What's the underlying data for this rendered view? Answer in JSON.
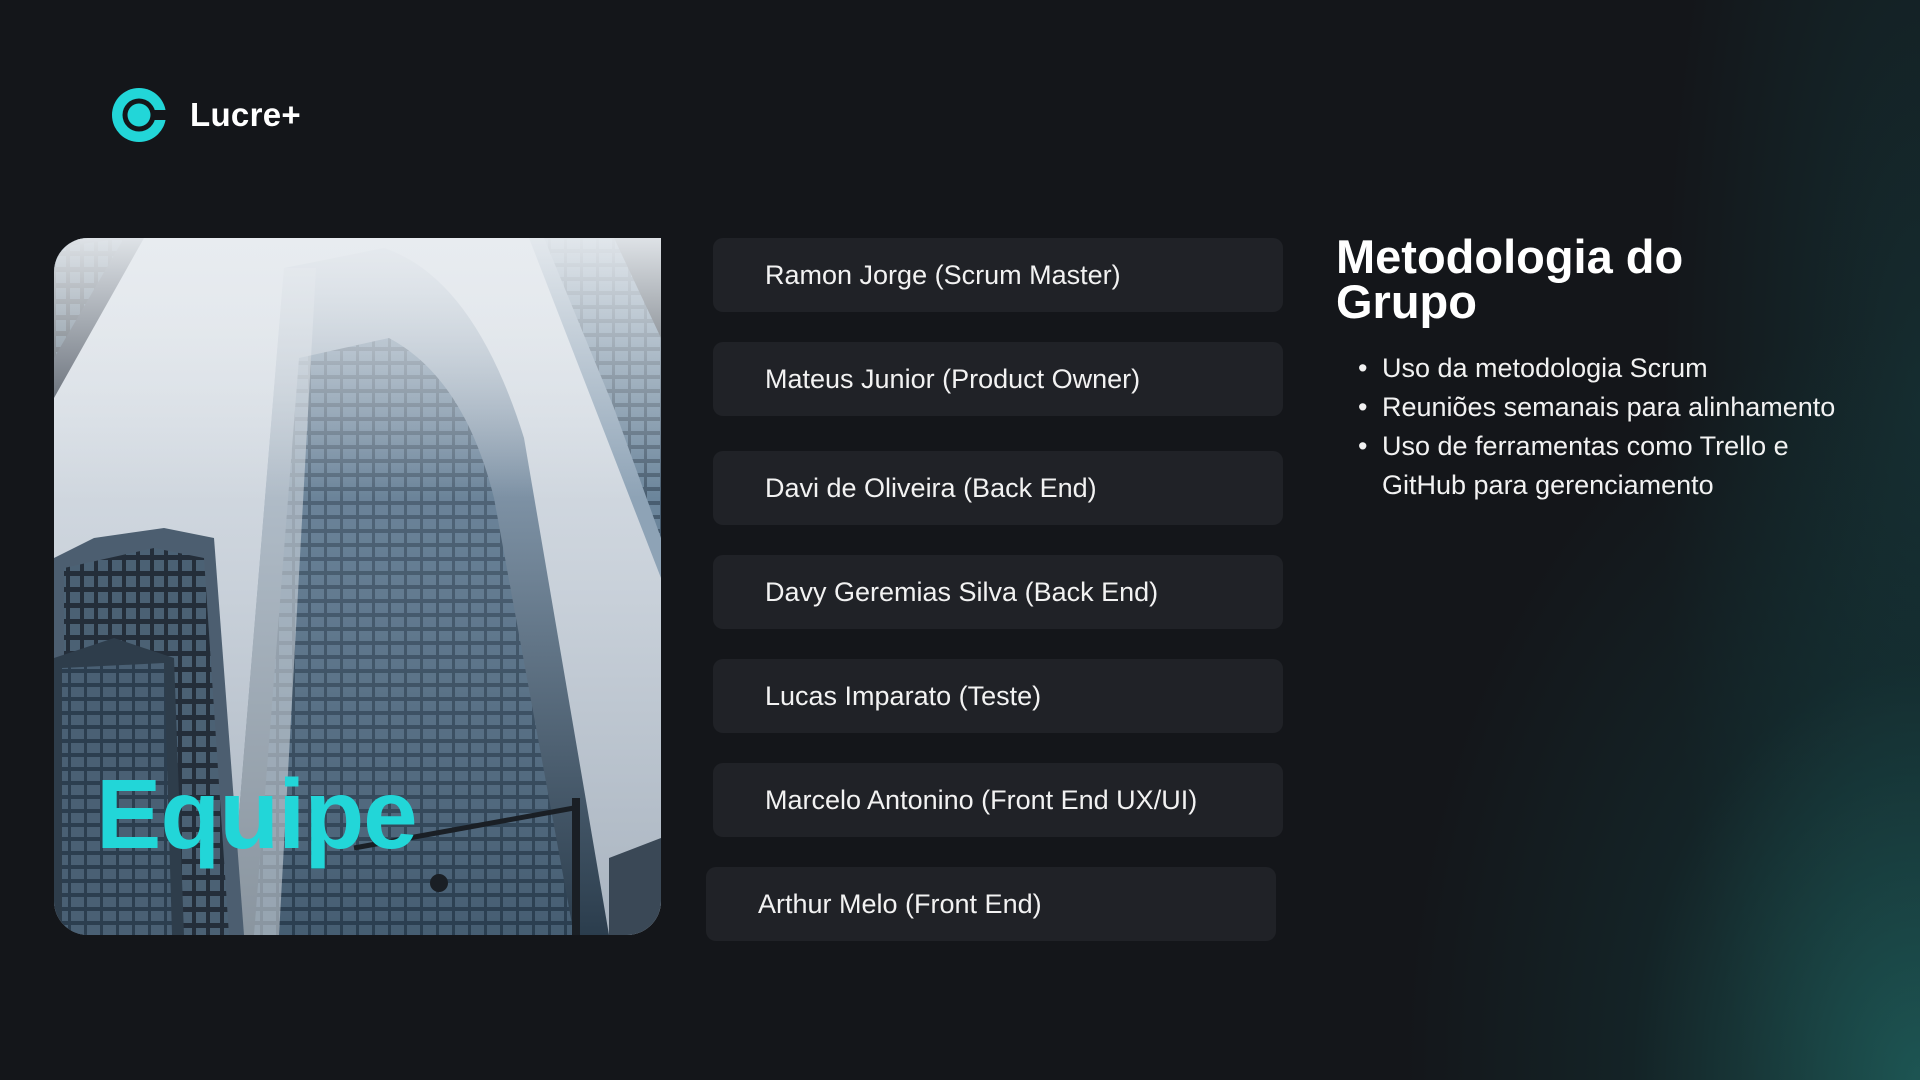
{
  "brand": {
    "name": "Lucre+",
    "accent_color": "#22d6d8"
  },
  "photo_card": {
    "title": "Equipe",
    "image": "skyscraper-photo"
  },
  "team_members": [
    {
      "label": "Ramon Jorge (Scrum Master)"
    },
    {
      "label": "Mateus Junior (Product Owner)"
    },
    {
      "label": "Davi de Oliveira (Back End)"
    },
    {
      "label": "Davy Geremias Silva (Back End)"
    },
    {
      "label": "Lucas Imparato (Teste)"
    },
    {
      "label": "Marcelo Antonino (Front End UX/UI)"
    },
    {
      "label": "Arthur Melo (Front End)"
    }
  ],
  "methodology": {
    "title": "Metodologia do Grupo",
    "items": [
      "Uso da metodologia Scrum",
      "Reuniões semanais para alinhamento",
      "Uso de ferramentas como Trello e GitHub para gerenciamento"
    ]
  }
}
